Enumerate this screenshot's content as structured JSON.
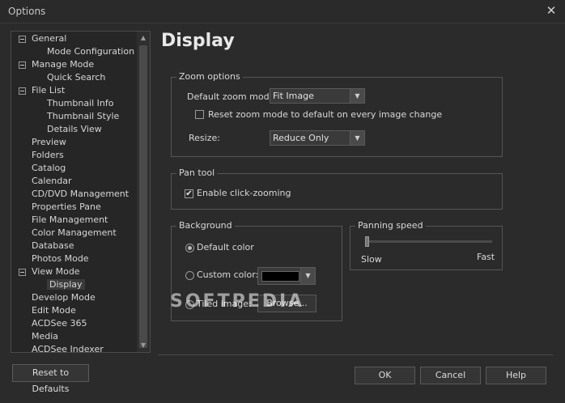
{
  "window": {
    "title": "Options",
    "close_glyph": "✕"
  },
  "tree": {
    "items": [
      {
        "label": "General",
        "level": 0,
        "expanded": true
      },
      {
        "label": "Mode Configuration",
        "level": 1
      },
      {
        "label": "Manage Mode",
        "level": 0,
        "expanded": true
      },
      {
        "label": "Quick Search",
        "level": 1
      },
      {
        "label": "File List",
        "level": 0,
        "expanded": true
      },
      {
        "label": "Thumbnail Info",
        "level": 1
      },
      {
        "label": "Thumbnail Style",
        "level": 1
      },
      {
        "label": "Details View",
        "level": 1
      },
      {
        "label": "Preview",
        "level": 0
      },
      {
        "label": "Folders",
        "level": 0
      },
      {
        "label": "Catalog",
        "level": 0
      },
      {
        "label": "Calendar",
        "level": 0
      },
      {
        "label": "CD/DVD Management",
        "level": 0
      },
      {
        "label": "Properties Pane",
        "level": 0
      },
      {
        "label": "File Management",
        "level": 0
      },
      {
        "label": "Color Management",
        "level": 0
      },
      {
        "label": "Database",
        "level": 0
      },
      {
        "label": "Photos Mode",
        "level": 0
      },
      {
        "label": "View Mode",
        "level": 0,
        "expanded": true
      },
      {
        "label": "Display",
        "level": 1,
        "selected": true
      },
      {
        "label": "Develop Mode",
        "level": 0
      },
      {
        "label": "Edit Mode",
        "level": 0
      },
      {
        "label": "ACDSee 365",
        "level": 0
      },
      {
        "label": "Media",
        "level": 0
      },
      {
        "label": "ACDSee Indexer",
        "level": 0
      }
    ],
    "scroll_up": "▲",
    "scroll_down": "▼"
  },
  "page": {
    "title": "Display",
    "zoom": {
      "legend": "Zoom options",
      "default_zoom_label": "Default zoom mode:",
      "default_zoom_value": "Fit Image",
      "reset_checkbox_label": "Reset zoom mode to default on every image change",
      "reset_checked": false,
      "resize_label": "Resize:",
      "resize_value": "Reduce Only"
    },
    "pan": {
      "legend": "Pan tool",
      "enable_label": "Enable click-zooming",
      "enable_checked": true
    },
    "background": {
      "legend": "Background",
      "default_color_label": "Default color",
      "custom_color_label": "Custom color:",
      "tiled_image_label": "Tiled image:",
      "browse_label": "Browse...",
      "selected": "default",
      "custom_color": "#000000"
    },
    "panning": {
      "legend": "Panning speed",
      "slow": "Slow",
      "fast": "Fast",
      "level": 0.0
    }
  },
  "buttons": {
    "reset": "Reset to Defaults",
    "ok": "OK",
    "cancel": "Cancel",
    "help": "Help"
  },
  "watermark": "SOFTPEDIA",
  "check_glyph": "✔",
  "dropdown_glyph": "▼"
}
